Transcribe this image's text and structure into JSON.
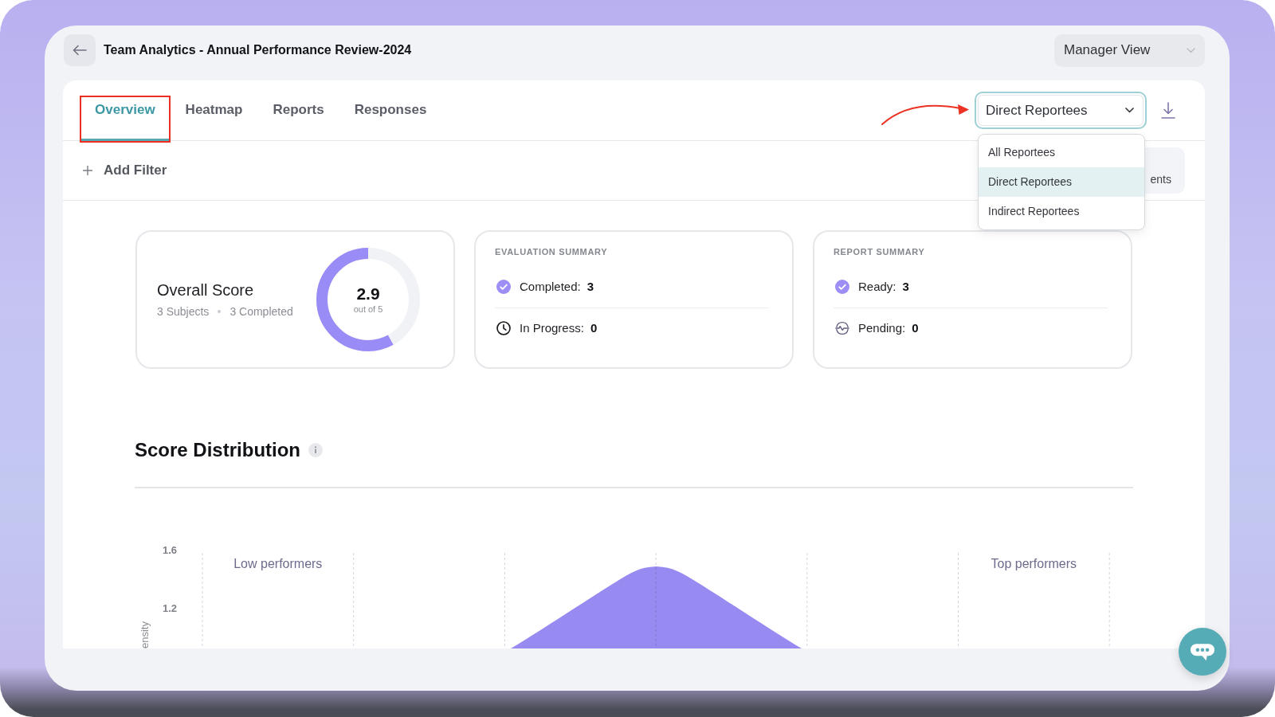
{
  "header": {
    "title": "Team Analytics - Annual Performance Review-2024",
    "view_select": {
      "value": "Manager View"
    }
  },
  "tabs": [
    {
      "label": "Overview",
      "selected": true,
      "highlighted": true
    },
    {
      "label": "Heatmap",
      "selected": false,
      "highlighted": false
    },
    {
      "label": "Reports",
      "selected": false,
      "highlighted": false
    },
    {
      "label": "Responses",
      "selected": false,
      "highlighted": false
    }
  ],
  "audience_select": {
    "value": "Direct Reportees",
    "open": true,
    "pointer_arrow": true,
    "options": [
      {
        "label": "All Reportees",
        "selected": false
      },
      {
        "label": "Direct Reportees",
        "selected": true
      },
      {
        "label": "Indirect Reportees",
        "selected": false
      }
    ]
  },
  "filter_bar": {
    "add_filter": "Add Filter",
    "covered_button": "ents"
  },
  "overall_score": {
    "title": "Overall Score",
    "subjects": "3 Subjects",
    "completed": "3 Completed",
    "score": "2.9",
    "scale": "out of 5",
    "level": 0.58
  },
  "summaries": [
    {
      "title": "EVALUATION SUMMARY",
      "rows": [
        {
          "kind": "check",
          "label": "Completed:",
          "value": "3"
        },
        {
          "kind": "clock",
          "label": "In Progress:",
          "value": "0"
        }
      ]
    },
    {
      "title": "REPORT SUMMARY",
      "rows": [
        {
          "kind": "check",
          "label": "Ready:",
          "value": "3"
        },
        {
          "kind": "pulse",
          "label": "Pending:",
          "value": "0"
        }
      ]
    }
  ],
  "score_distribution": {
    "title": "Score Distribution",
    "chart": {
      "y_axis_label": "ensity",
      "y_ticks": [
        "1.6",
        "1.2"
      ],
      "band_labels": [
        "Low performers",
        "Top performers"
      ]
    }
  }
}
